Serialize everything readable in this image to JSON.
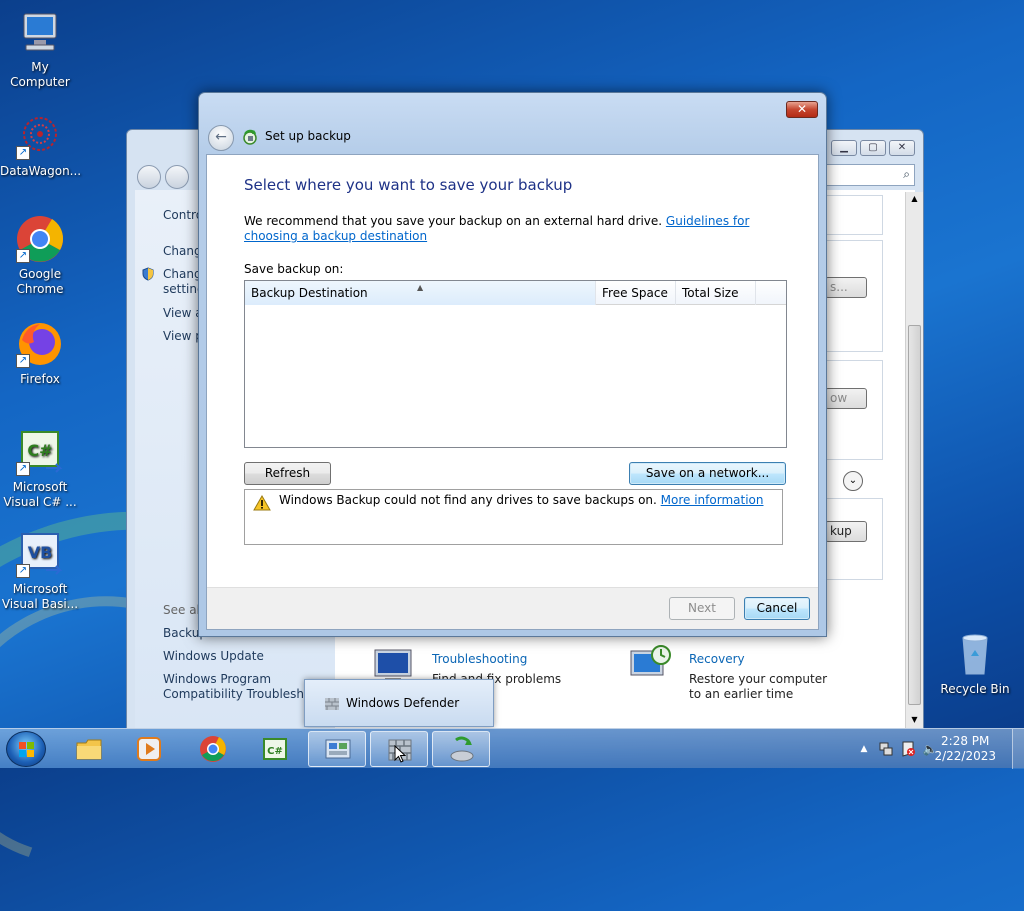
{
  "desktop": {
    "icons": [
      {
        "label": "My Computer",
        "icon": "computer-icon"
      },
      {
        "label": "DataWagon...",
        "icon": "datawagon-icon"
      },
      {
        "label": "Google Chrome",
        "icon": "chrome-icon"
      },
      {
        "label": "Firefox",
        "icon": "firefox-icon"
      },
      {
        "label": "Microsoft Visual C# ...",
        "icon": "visual-csharp-icon"
      },
      {
        "label": "Microsoft Visual Basi...",
        "icon": "visual-basic-icon"
      },
      {
        "label": "Recycle Bin",
        "icon": "recycle-bin-icon"
      }
    ]
  },
  "background_window": {
    "left_pane": {
      "items": [
        "Contro",
        "Chang",
        "Chang setting",
        "View a",
        "View p"
      ],
      "see_also": "See als",
      "links": [
        "Backup",
        "Windows Update",
        "Windows Program Compatibility Troubleshoo"
      ]
    },
    "buttons": [
      "s...",
      "ow",
      "kup"
    ],
    "bottom_items": [
      {
        "title": "Troubleshooting",
        "text": "Find and fix problems"
      },
      {
        "title": "Recovery",
        "text": "Restore your computer to an earlier time"
      }
    ]
  },
  "dialog": {
    "title": "Set up backup",
    "close_label": "✕",
    "heading": "Select where you want to save your backup",
    "recommend_text": "We recommend that you save your backup on an external hard drive. ",
    "recommend_link": "Guidelines for choosing a backup destination",
    "save_on_label": "Save backup on:",
    "columns": [
      "Backup Destination",
      "Free Space",
      "Total Size"
    ],
    "rows": [],
    "refresh_label": "Refresh",
    "network_label": "Save on a network...",
    "warning_text": "Windows Backup could not find any drives to save backups on. ",
    "warning_link": "More information",
    "next_label": "Next",
    "cancel_label": "Cancel"
  },
  "tooltip": {
    "text": "Windows Defender"
  },
  "taskbar": {
    "items": [
      {
        "icon": "file-explorer-icon",
        "active": false
      },
      {
        "icon": "media-player-icon",
        "active": false
      },
      {
        "icon": "chrome-icon",
        "active": false
      },
      {
        "icon": "visual-csharp-icon",
        "active": false
      },
      {
        "icon": "control-panel-icon",
        "active": true
      },
      {
        "icon": "windows-defender-icon",
        "active": true
      },
      {
        "icon": "backup-icon",
        "active": true
      }
    ],
    "time": "2:28 PM",
    "date": "2/22/2023"
  }
}
